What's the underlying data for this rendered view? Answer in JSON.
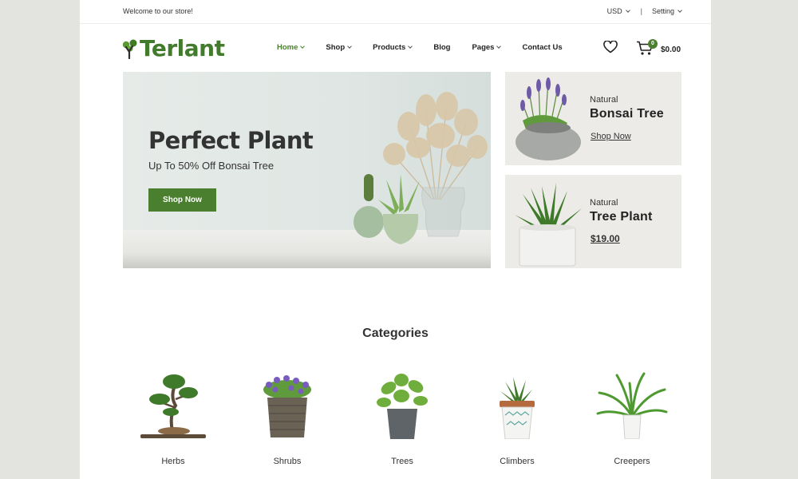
{
  "topbar": {
    "welcome": "Welcome to our store!",
    "currency": "USD",
    "separator": "|",
    "setting": "Setting"
  },
  "header": {
    "logo": "Terlant",
    "nav": [
      {
        "label": "Home",
        "has_dropdown": true,
        "active": true
      },
      {
        "label": "Shop",
        "has_dropdown": true
      },
      {
        "label": "Products",
        "has_dropdown": true
      },
      {
        "label": "Blog",
        "has_dropdown": false
      },
      {
        "label": "Pages",
        "has_dropdown": true
      },
      {
        "label": "Contact Us",
        "has_dropdown": false
      }
    ],
    "wishlist_icon": "heart-icon",
    "cart_icon": "cart-icon",
    "cart_count": "0",
    "cart_total": "$0.00"
  },
  "hero": {
    "title": "Perfect Plant",
    "subtitle": "Up To 50% Off Bonsai Tree",
    "button": "Shop Now"
  },
  "banners": [
    {
      "kicker": "Natural",
      "title": "Bonsai Tree",
      "link": "Shop Now"
    },
    {
      "kicker": "Natural",
      "title": "Tree Plant",
      "price": "$19.00"
    }
  ],
  "categories": {
    "heading": "Categories",
    "items": [
      {
        "label": "Herbs"
      },
      {
        "label": "Shrubs"
      },
      {
        "label": "Trees"
      },
      {
        "label": "Climbers"
      },
      {
        "label": "Creepers"
      }
    ]
  },
  "colors": {
    "brand_green": "#4a7f2f",
    "background": "#e3e4e0",
    "banner_bg": "#ecebe8"
  }
}
